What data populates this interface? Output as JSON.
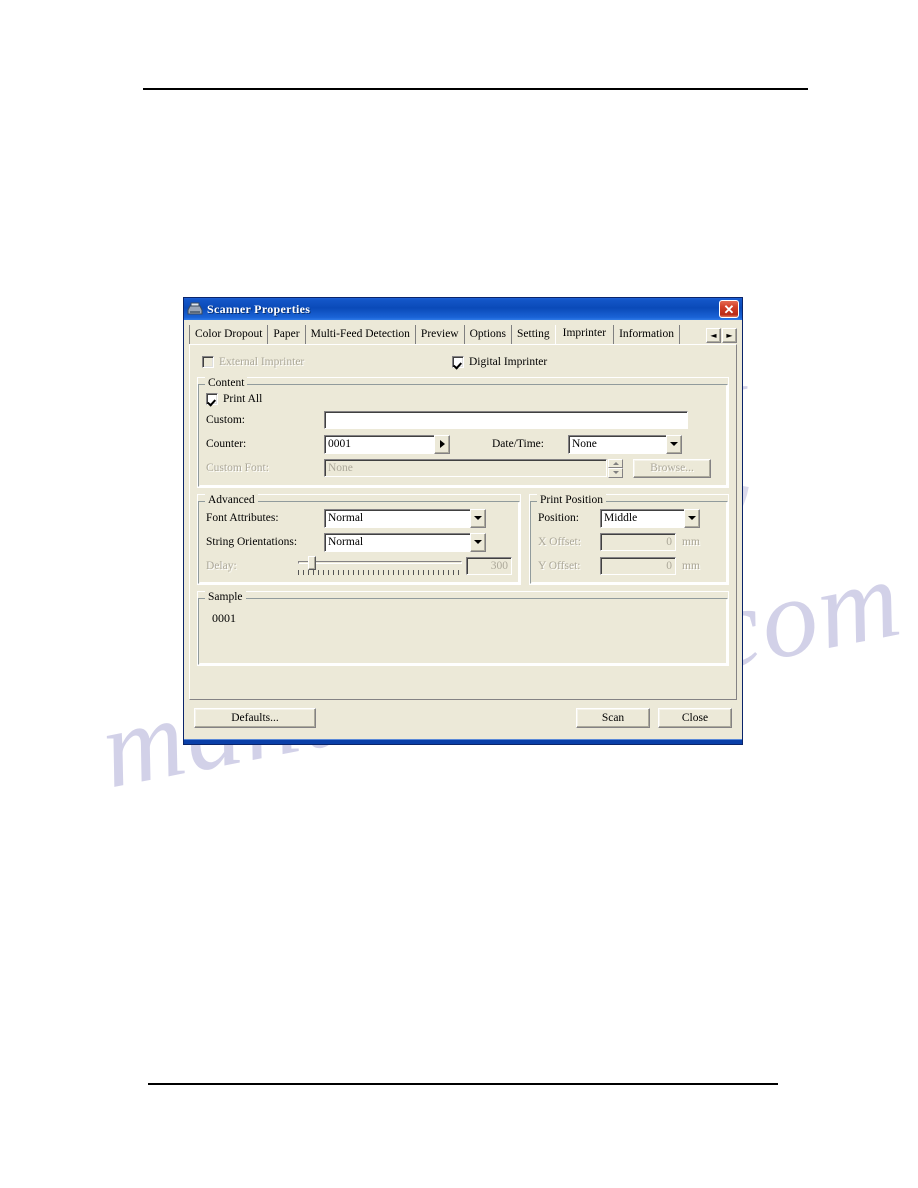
{
  "window": {
    "title": "Scanner Properties",
    "icon": "scanner-icon",
    "close_label": "✕"
  },
  "tabs": {
    "items": [
      {
        "label": "Color Dropout",
        "active": false
      },
      {
        "label": "Paper",
        "active": false
      },
      {
        "label": "Multi-Feed Detection",
        "active": false
      },
      {
        "label": "Preview",
        "active": false
      },
      {
        "label": "Options",
        "active": false
      },
      {
        "label": "Setting",
        "active": false
      },
      {
        "label": "Imprinter",
        "active": true
      },
      {
        "label": "Information",
        "active": false
      }
    ],
    "scroll_left": "◄",
    "scroll_right": "►"
  },
  "imprinter": {
    "external_imprinter": {
      "label": "External Imprinter",
      "checked": false,
      "enabled": false
    },
    "digital_imprinter": {
      "label": "Digital Imprinter",
      "checked": true,
      "enabled": true
    },
    "content": {
      "group_label": "Content",
      "print_all": {
        "label": "Print All",
        "checked": true
      },
      "custom": {
        "label": "Custom:",
        "value": "",
        "placeholder": ""
      },
      "counter": {
        "label": "Counter:",
        "value": "0001"
      },
      "datetime": {
        "label": "Date/Time:",
        "value": "None"
      },
      "custom_font": {
        "label": "Custom Font:",
        "value": "None",
        "enabled": false
      },
      "browse_button": {
        "label": "Browse...",
        "enabled": false
      }
    },
    "advanced": {
      "group_label": "Advanced",
      "font_attributes": {
        "label": "Font Attributes:",
        "value": "Normal"
      },
      "string_orientations": {
        "label": "String Orientations:",
        "value": "Normal"
      },
      "delay": {
        "label": "Delay:",
        "value": "300",
        "enabled": false,
        "percent": 6
      }
    },
    "print_position": {
      "group_label": "Print Position",
      "position": {
        "label": "Position:",
        "value": "Middle"
      },
      "x_offset": {
        "label": "X Offset:",
        "value": "0",
        "unit": "mm",
        "enabled": false
      },
      "y_offset": {
        "label": "Y Offset:",
        "value": "0",
        "unit": "mm",
        "enabled": false
      }
    },
    "sample": {
      "group_label": "Sample",
      "value": "0001"
    }
  },
  "buttons": {
    "defaults": "Defaults...",
    "scan": "Scan",
    "close": "Close"
  },
  "watermark": {
    "line1": "manualsh",
    "line2": "manualshive.com"
  },
  "colors": {
    "titlebar_blue": "#0a4ab8",
    "dialog_face": "#ece9d8",
    "disabled_text": "#aca899",
    "close_red": "#d4412a"
  }
}
